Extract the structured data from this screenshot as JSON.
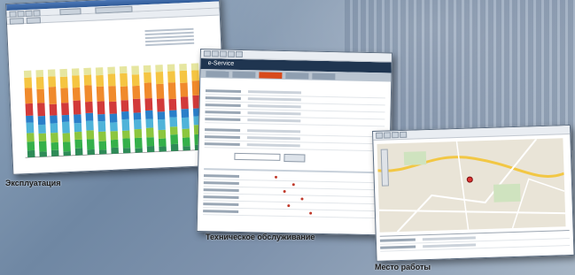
{
  "captions": {
    "operation": "Эксплуатация",
    "maintenance": "Техническое  обслуживание",
    "workplace": "Место работы"
  },
  "service_window": {
    "header_title": "e-Service"
  },
  "colors": {
    "bar_colors": [
      "#2e8b57",
      "#35b04a",
      "#8cc63f",
      "#4fb3d9",
      "#2a7fc9",
      "#d23a3a",
      "#f08a2c",
      "#f5c542",
      "#e6e6a0"
    ],
    "window_accent": "#d84a1b",
    "map_bg": "#e9e4d7"
  },
  "chart_data": {
    "type": "bar",
    "stacked": true,
    "categories": [
      "",
      "",
      "",
      "",
      "",
      "",
      "",
      "",
      "",
      "",
      "",
      "",
      "",
      "",
      "",
      ""
    ],
    "series": [
      {
        "values": [
          0.08,
          0.06,
          0.07,
          0.05,
          0.08,
          0.06,
          0.05,
          0.07,
          0.06,
          0.05,
          0.07,
          0.06,
          0.08,
          0.05,
          0.06,
          0.07
        ]
      },
      {
        "values": [
          0.1,
          0.12,
          0.09,
          0.11,
          0.1,
          0.12,
          0.1,
          0.09,
          0.11,
          0.12,
          0.1,
          0.09,
          0.11,
          0.1,
          0.12,
          0.1
        ]
      },
      {
        "values": [
          0.1,
          0.09,
          0.11,
          0.1,
          0.09,
          0.1,
          0.11,
          0.1,
          0.09,
          0.1,
          0.11,
          0.1,
          0.09,
          0.1,
          0.11,
          0.09
        ]
      },
      {
        "values": [
          0.12,
          0.1,
          0.11,
          0.13,
          0.1,
          0.11,
          0.12,
          0.1,
          0.13,
          0.11,
          0.1,
          0.12,
          0.11,
          0.13,
          0.1,
          0.11
        ]
      },
      {
        "values": [
          0.08,
          0.1,
          0.09,
          0.08,
          0.1,
          0.09,
          0.08,
          0.1,
          0.09,
          0.08,
          0.1,
          0.09,
          0.08,
          0.1,
          0.09,
          0.08
        ]
      },
      {
        "values": [
          0.14,
          0.15,
          0.13,
          0.14,
          0.16,
          0.13,
          0.15,
          0.14,
          0.13,
          0.16,
          0.14,
          0.15,
          0.13,
          0.14,
          0.15,
          0.13
        ]
      },
      {
        "values": [
          0.18,
          0.16,
          0.2,
          0.17,
          0.15,
          0.19,
          0.17,
          0.18,
          0.16,
          0.15,
          0.18,
          0.17,
          0.19,
          0.16,
          0.17,
          0.18
        ]
      },
      {
        "values": [
          0.12,
          0.14,
          0.12,
          0.13,
          0.14,
          0.12,
          0.13,
          0.14,
          0.15,
          0.13,
          0.12,
          0.14,
          0.13,
          0.14,
          0.12,
          0.15
        ]
      },
      {
        "values": [
          0.08,
          0.08,
          0.08,
          0.09,
          0.08,
          0.08,
          0.09,
          0.08,
          0.08,
          0.1,
          0.08,
          0.08,
          0.08,
          0.08,
          0.08,
          0.09
        ]
      }
    ],
    "ylim": [
      0,
      1.1
    ]
  }
}
